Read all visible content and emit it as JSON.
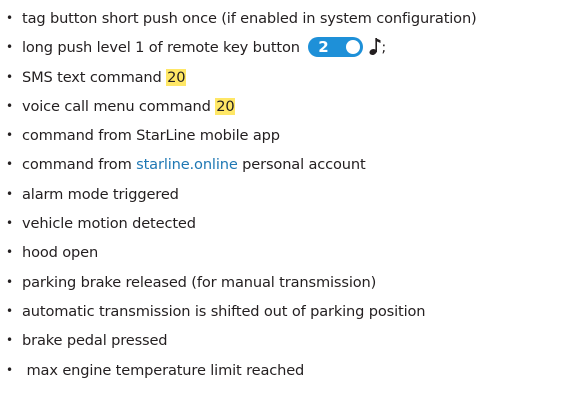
{
  "bullet": "•",
  "items": [
    {
      "text": "tag button short push once (if enabled in system configuration)"
    },
    {
      "text_before": "long push level 1 of remote key button",
      "key_number": "2",
      "text_after": ";"
    },
    {
      "text": "SMS text command",
      "badge": "20"
    },
    {
      "text": "voice call menu command",
      "badge": "20"
    },
    {
      "text": "command from StarLine mobile app"
    },
    {
      "text_before": "command from",
      "link": "starline.online",
      "text_after": "personal account"
    },
    {
      "text": "alarm mode triggered"
    },
    {
      "text": "vehicle motion detected"
    },
    {
      "text": "hood open"
    },
    {
      "text": "parking brake released (for manual transmission)"
    },
    {
      "text": "automatic transmission is shifted out of parking position"
    },
    {
      "text": "brake pedal pressed"
    },
    {
      "text": " max engine temperature limit reached"
    }
  ],
  "icons": {
    "key_button": "remote-key-button-icon",
    "sound": "music-note-icon"
  },
  "colors": {
    "text": "#231f20",
    "highlight": "#ffe766",
    "link": "#1f78b4",
    "key_button": "#1e90d8"
  }
}
